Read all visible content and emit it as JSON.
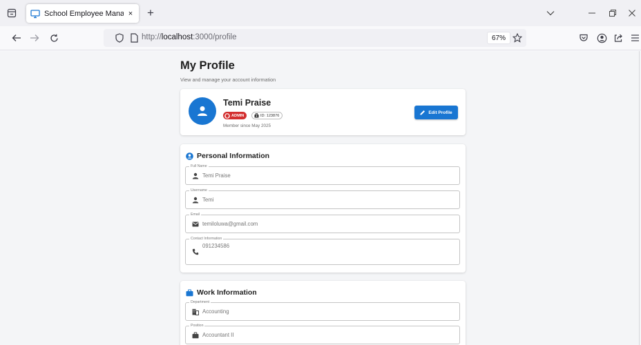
{
  "browser": {
    "tab_title": "School Employee Management",
    "tab_close": "×",
    "new_tab": "+",
    "url_prefix": "http://",
    "url_host": "localhost",
    "url_rest": ":3000/profile",
    "zoom": "67%"
  },
  "page": {
    "title": "My Profile",
    "subtitle": "View and manage your account information"
  },
  "profile": {
    "name": "Temi Praise",
    "role_badge": "ADMIN",
    "id_badge": "ID: 123876",
    "member_since": "Member since May 2025",
    "edit_button": "Edit Profile"
  },
  "personal": {
    "title": "Personal Information",
    "fields": [
      {
        "label": "Full Name",
        "value": "Temi Praise",
        "icon": "person-icon"
      },
      {
        "label": "Username",
        "value": "Temi",
        "icon": "person-icon"
      },
      {
        "label": "Email",
        "value": "temiloluwa@gmail.com",
        "icon": "email-icon"
      },
      {
        "label": "Contact Information",
        "value": "091234586",
        "icon": "phone-icon"
      }
    ]
  },
  "work": {
    "title": "Work Information",
    "fields": [
      {
        "label": "Department",
        "value": "Accounting",
        "icon": "department-icon"
      },
      {
        "label": "Position",
        "value": "Accountant II",
        "icon": "briefcase-icon"
      }
    ]
  },
  "colors": {
    "primary": "#1976d2",
    "admin_badge": "#d32f2f",
    "page_bg": "#f4f5f7"
  }
}
